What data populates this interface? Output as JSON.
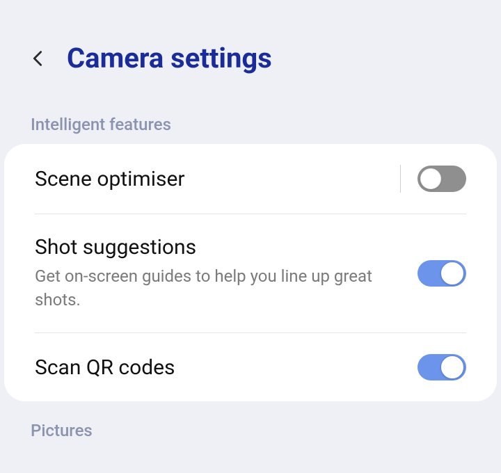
{
  "header": {
    "title": "Camera settings"
  },
  "sections": {
    "intelligent": {
      "label": "Intelligent features",
      "items": {
        "scene_optimiser": {
          "title": "Scene optimiser",
          "on": false
        },
        "shot_suggestions": {
          "title": "Shot suggestions",
          "desc": "Get on-screen guides to help you line up great shots.",
          "on": true
        },
        "scan_qr_codes": {
          "title": "Scan QR codes",
          "on": true
        }
      }
    },
    "pictures": {
      "label": "Pictures"
    }
  },
  "colors": {
    "accent_title": "#1a2c9a",
    "toggle_on": "#6b94ea",
    "toggle_off": "#8f8f8f"
  }
}
